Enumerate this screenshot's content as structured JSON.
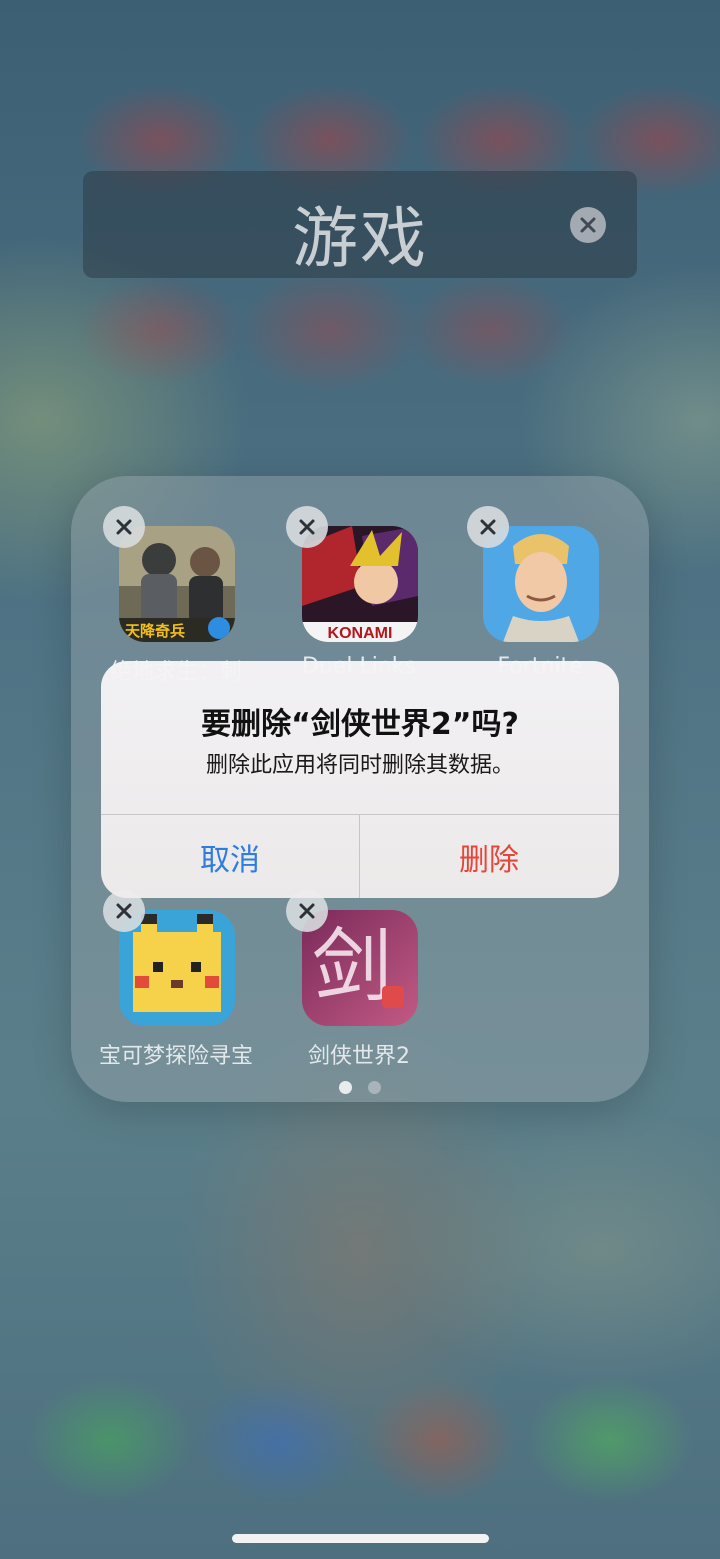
{
  "folder": {
    "title": "游戏",
    "apps": [
      {
        "label": "绝地求生：刺",
        "icon": "pubg-app-icon",
        "badge": "天降奇兵"
      },
      {
        "label": "Duel Links",
        "icon": "yugioh-app-icon",
        "badge": "KONAMI"
      },
      {
        "label": "Fortnite",
        "icon": "fortnite-app-icon"
      },
      {
        "label": "宝可梦探险寻宝",
        "icon": "pokemon-quest-app-icon"
      },
      {
        "label": "剑侠世界2",
        "icon": "jianxia-app-icon",
        "glyph": "剑"
      }
    ],
    "page_count": 2,
    "current_page": 1
  },
  "alert": {
    "title": "要删除“剑侠世界2”吗?",
    "message": "删除此应用将同时删除其数据。",
    "cancel_label": "取消",
    "delete_label": "删除"
  },
  "colors": {
    "cancel": "#2f7ce0",
    "delete": "#e6453a"
  }
}
